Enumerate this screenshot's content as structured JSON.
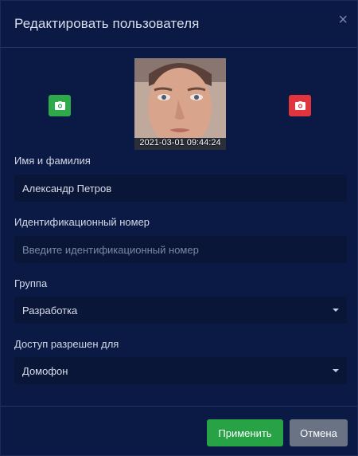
{
  "dialog": {
    "title": "Редактировать пользователя",
    "close_label": "×"
  },
  "photo": {
    "timestamp": "2021-03-01 09:44:24",
    "add_icon": "camera-icon",
    "remove_icon": "camera-icon",
    "add_color": "#2eaa4a",
    "remove_color": "#e0343f"
  },
  "form": {
    "name": {
      "label": "Имя и фамилия",
      "value": "Александр Петров"
    },
    "id_number": {
      "label": "Идентификационный номер",
      "placeholder": "Введите идентификационный номер"
    },
    "group": {
      "label": "Группа",
      "value": "Разработка"
    },
    "access": {
      "label": "Доступ разрешен для",
      "value": "Домофон"
    }
  },
  "buttons": {
    "apply": "Применить",
    "cancel": "Отмена"
  }
}
